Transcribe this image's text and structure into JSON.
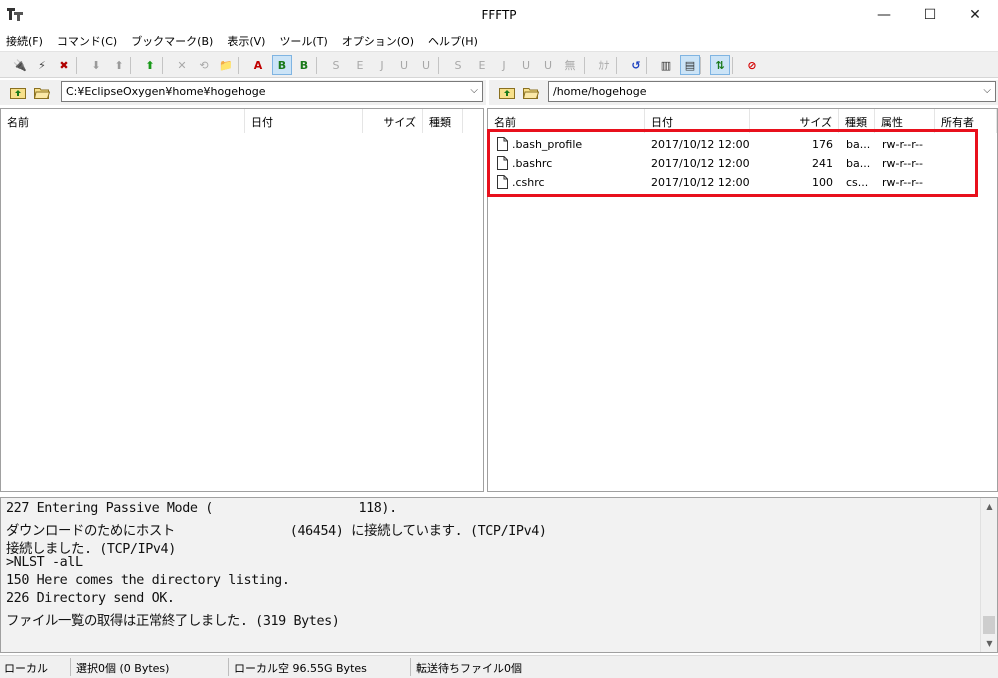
{
  "window": {
    "title": "FFFTP",
    "minimize": "—",
    "maximize": "☐",
    "close": "✕"
  },
  "menu": [
    "接続(F)",
    "コマンド(C)",
    "ブックマーク(B)",
    "表示(V)",
    "ツール(T)",
    "オプション(O)",
    "ヘルプ(H)"
  ],
  "toolbar": {
    "buttons": [
      {
        "name": "connect-icon",
        "glyph": "🔌",
        "color": "#d40000"
      },
      {
        "name": "quick-connect-icon",
        "glyph": "⚡",
        "color": "#444"
      },
      {
        "name": "disconnect-icon",
        "glyph": "✖",
        "color": "#b00000"
      },
      {
        "name": "download-icon",
        "glyph": "⬇",
        "color": "#9a9a9a"
      },
      {
        "name": "upload-icon",
        "glyph": "⬆",
        "color": "#9a9a9a"
      },
      {
        "name": "mirror-upload-icon",
        "glyph": "⬆",
        "color": "#1a9a1a"
      },
      {
        "name": "delete-icon",
        "glyph": "✕",
        "color": "#a8a8a8"
      },
      {
        "name": "rename-icon",
        "glyph": "⟲",
        "color": "#a8a8a8"
      },
      {
        "name": "mkdir-icon",
        "glyph": "📁",
        "color": "#c8a000"
      },
      {
        "name": "ascii-mode-icon",
        "glyph": "A",
        "color": "#c00000"
      },
      {
        "name": "binary-mode-icon",
        "glyph": "B",
        "color": "#1a7a1a"
      },
      {
        "name": "auto-mode-icon",
        "glyph": "B",
        "color": "#1a7a1a"
      },
      {
        "name": "kanji-sjis-icon",
        "glyph": "S",
        "color": "#a8a8a8"
      },
      {
        "name": "kanji-euc-icon",
        "glyph": "E",
        "color": "#a8a8a8"
      },
      {
        "name": "kanji-jis-icon",
        "glyph": "J",
        "color": "#a8a8a8"
      },
      {
        "name": "kanji-utf8-icon",
        "glyph": "U",
        "color": "#a8a8a8"
      },
      {
        "name": "kanji-utf8bom-icon",
        "glyph": "U",
        "color": "#a8a8a8"
      },
      {
        "name": "kanji-sjis-remote-icon",
        "glyph": "S",
        "color": "#a8a8a8"
      },
      {
        "name": "kanji-euc-remote-icon",
        "glyph": "E",
        "color": "#a8a8a8"
      },
      {
        "name": "kanji-jis-remote-icon",
        "glyph": "J",
        "color": "#a8a8a8"
      },
      {
        "name": "kanji-utf8-remote-icon",
        "glyph": "U",
        "color": "#a8a8a8"
      },
      {
        "name": "kanji-utf8bom-remote-icon",
        "glyph": "U",
        "color": "#a8a8a8"
      },
      {
        "name": "kanji-none-icon",
        "glyph": "無",
        "color": "#a8a8a8"
      },
      {
        "name": "kana-convert-icon",
        "glyph": "ｶﾅ",
        "color": "#a8a8a8"
      },
      {
        "name": "refresh-icon",
        "glyph": "↺",
        "color": "#1a3fbf"
      },
      {
        "name": "list-view-icon",
        "glyph": "▥",
        "color": "#333"
      },
      {
        "name": "detail-view-icon",
        "glyph": "▤",
        "color": "#333"
      },
      {
        "name": "sync-dirs-icon",
        "glyph": "⇅",
        "color": "#1a7a1a"
      },
      {
        "name": "stop-icon",
        "glyph": "⊘",
        "color": "#d40000"
      }
    ]
  },
  "local": {
    "path": "C:¥EclipseOxygen¥home¥hogehoge",
    "columns": [
      "名前",
      "日付",
      "サイズ",
      "種類"
    ],
    "files": []
  },
  "remote": {
    "path": "/home/hogehoge",
    "columns": [
      "名前",
      "日付",
      "サイズ",
      "種類",
      "属性",
      "所有者"
    ],
    "files": [
      {
        "name": ".bash_profile",
        "date": "2017/10/12 12:00",
        "size": "176",
        "type": "ba...",
        "attr": "rw-r--r--"
      },
      {
        "name": ".bashrc",
        "date": "2017/10/12 12:00",
        "size": "241",
        "type": "ba...",
        "attr": "rw-r--r--"
      },
      {
        "name": ".cshrc",
        "date": "2017/10/12 12:00",
        "size": "100",
        "type": "cs...",
        "attr": "rw-r--r--"
      }
    ]
  },
  "log": [
    "227 Entering Passive Mode (                   118).",
    "ダウンロードのためにホスト               (46454) に接続しています. (TCP/IPv4)",
    "接続しました. (TCP/IPv4)",
    ">NLST -alL",
    "150 Here comes the directory listing.",
    "226 Directory send OK.",
    "ファイル一覧の取得は正常終了しました. (319 Bytes)"
  ],
  "status": {
    "side": "ローカル",
    "selection": "選択0個 (0 Bytes)",
    "free": "ローカル空 96.55G Bytes",
    "queue": "転送待ちファイル0個"
  },
  "colors": {
    "highlight": "#e8101c",
    "toolbar_bg": "#f0f0f0",
    "log_bg": "#f2f2f2"
  }
}
